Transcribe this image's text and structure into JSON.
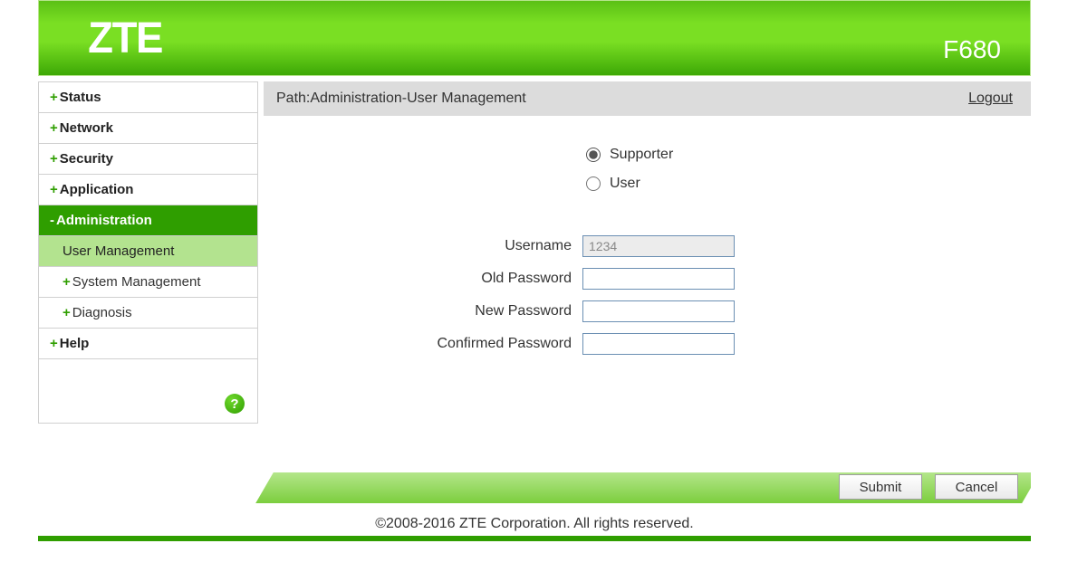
{
  "header": {
    "logo": "ZTE",
    "model": "F680"
  },
  "sidebar": {
    "items": [
      {
        "label": "Status",
        "prefix": "+",
        "type": "top"
      },
      {
        "label": "Network",
        "prefix": "+",
        "type": "top"
      },
      {
        "label": "Security",
        "prefix": "+",
        "type": "top"
      },
      {
        "label": "Application",
        "prefix": "+",
        "type": "top"
      },
      {
        "label": "Administration",
        "prefix": "-",
        "type": "top-active"
      },
      {
        "label": "User Management",
        "prefix": "",
        "type": "sub-selected"
      },
      {
        "label": "System Management",
        "prefix": "+",
        "type": "sub"
      },
      {
        "label": "Diagnosis",
        "prefix": "+",
        "type": "sub"
      },
      {
        "label": "Help",
        "prefix": "+",
        "type": "top"
      }
    ],
    "help_icon": "?"
  },
  "pathbar": {
    "text": "Path:Administration-User Management",
    "logout": "Logout"
  },
  "roles": {
    "supporter": "Supporter",
    "user": "User",
    "selected": "supporter"
  },
  "form": {
    "username_label": "Username",
    "username_value": "1234",
    "oldpw_label": "Old Password",
    "oldpw_value": "",
    "newpw_label": "New Password",
    "newpw_value": "",
    "confpw_label": "Confirmed Password",
    "confpw_value": ""
  },
  "buttons": {
    "submit": "Submit",
    "cancel": "Cancel"
  },
  "footer": {
    "copyright": "©2008-2016 ZTE Corporation. All rights reserved."
  }
}
